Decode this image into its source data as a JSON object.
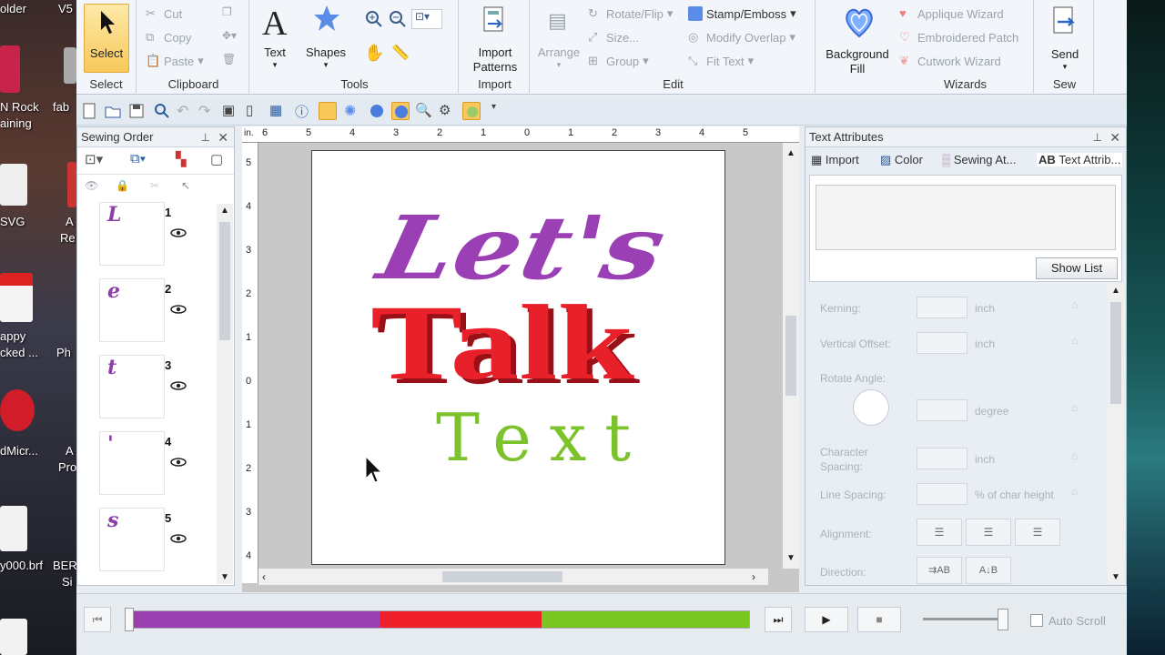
{
  "desktop": {
    "left_labels": [
      "older",
      "V5",
      "N Rock",
      "aining",
      "fab",
      "SVG",
      "A",
      "Re",
      "appy",
      "cked ...",
      "Ph",
      "dMicr...",
      "A",
      "Pro",
      "y000.brf",
      "BER",
      "Si"
    ]
  },
  "ribbon": {
    "select_group": {
      "button": "Select",
      "label": "Select"
    },
    "clipboard_group": {
      "cut": "Cut",
      "copy": "Copy",
      "paste": "Paste",
      "label": "Clipboard"
    },
    "tools_group": {
      "text": "Text",
      "shapes": "Shapes",
      "label": "Tools"
    },
    "import_group": {
      "button_line1": "Import",
      "button_line2": "Patterns",
      "label": "Import"
    },
    "edit_group": {
      "arrange": "Arrange",
      "rotate_flip": "Rotate/Flip",
      "size": "Size...",
      "group": "Group",
      "stamp_emboss": "Stamp/Emboss",
      "modify_overlap": "Modify Overlap",
      "fit_text": "Fit Text",
      "label": "Edit"
    },
    "background_group": {
      "line1": "Background",
      "line2": "Fill"
    },
    "wizards_group": {
      "applique": "Applique Wizard",
      "embroidered_patch": "Embroidered Patch",
      "cutwork": "Cutwork Wizard",
      "label": "Wizards"
    },
    "sew_group": {
      "send": "Send",
      "label": "Sew"
    }
  },
  "sewing_order": {
    "title": "Sewing Order",
    "items": [
      {
        "num": "1",
        "color": "#8e3fa8",
        "glyph": "L"
      },
      {
        "num": "2",
        "color": "#8e3fa8",
        "glyph": "e"
      },
      {
        "num": "3",
        "color": "#8e3fa8",
        "glyph": "t"
      },
      {
        "num": "4",
        "color": "#8e3fa8",
        "glyph": "'"
      },
      {
        "num": "5",
        "color": "#8e3fa8",
        "glyph": "s"
      }
    ]
  },
  "canvas": {
    "line1": "Let's",
    "line2": "Talk",
    "line3": "Text",
    "colors": {
      "line1": "#9b3fb5",
      "line2": "#e8202a",
      "line3": "#7cc22a"
    },
    "hruler_labels": [
      "6",
      "5",
      "4",
      "3",
      "2",
      "1",
      "0",
      "1",
      "2",
      "3",
      "4",
      "5"
    ],
    "vruler_labels": [
      "5",
      "4",
      "3",
      "2",
      "1",
      "0",
      "1",
      "2",
      "3",
      "4"
    ],
    "ruler_unit": "in."
  },
  "text_attributes": {
    "title": "Text Attributes",
    "tabs": [
      "Import",
      "Color",
      "Sewing At...",
      "Text Attrib..."
    ],
    "show_list": "Show List",
    "kerning": "Kerning:",
    "vertical_offset": "Vertical Offset:",
    "rotate_angle": "Rotate Angle:",
    "character_spacing_1": "Character",
    "character_spacing_2": "Spacing:",
    "line_spacing": "Line Spacing:",
    "alignment": "Alignment:",
    "direction": "Direction:",
    "unit_inch": "inch",
    "unit_degree": "degree",
    "unit_percent": "% of char height"
  },
  "bottom": {
    "auto_scroll": "Auto Scroll",
    "progress_segments": [
      {
        "color": "#9a3fb0",
        "fraction": 0.405
      },
      {
        "color": "#ee1f2a",
        "fraction": 0.26
      },
      {
        "color": "#78c61f",
        "fraction": 0.335
      }
    ]
  }
}
